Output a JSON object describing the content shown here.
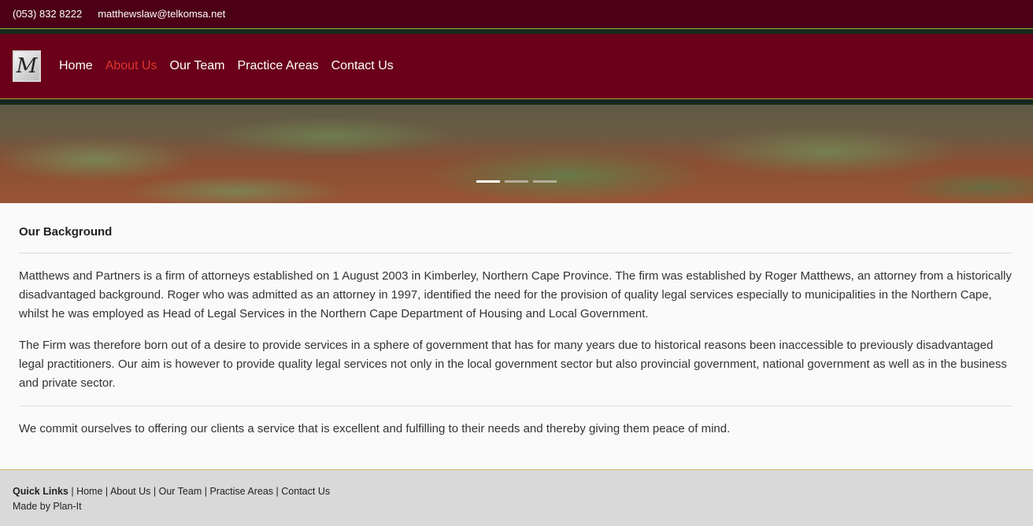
{
  "topbar": {
    "phone": "(053) 832 8222",
    "email": "matthewslaw@telkomsa.net"
  },
  "logo": {
    "letter": "M"
  },
  "nav": {
    "items": [
      {
        "label": "Home"
      },
      {
        "label": "About Us"
      },
      {
        "label": "Our Team"
      },
      {
        "label": "Practice Areas"
      },
      {
        "label": "Contact Us"
      }
    ],
    "active": "About Us"
  },
  "carousel": {
    "slides": 3,
    "active_index": 0
  },
  "content": {
    "heading": "Our Background",
    "paragraphs": [
      "Matthews and Partners is a firm of attorneys established on 1 August 2003 in Kimberley, Northern Cape Province. The firm was established by Roger Matthews, an attorney from a historically disadvantaged background. Roger who was admitted as an attorney in 1997, identified the need for the provision of quality legal services especially to municipalities in the Northern Cape, whilst he was employed as Head of Legal Services in the Northern Cape Department of Housing and Local Government.",
      "The Firm was therefore born out of a desire to provide services in a sphere of government that has for many years due to historical reasons been inaccessible to previously disadvantaged legal practitioners. Our aim is however to provide quality legal services not only in the local government sector but also provincial government, national government as well as in the business and private sector.",
      "We commit ourselves to offering our clients a service that is excellent and fulfilling to their needs and thereby giving them peace of mind."
    ]
  },
  "footer": {
    "quick_links_label": "Quick Links",
    "separator": "|",
    "links": [
      "Home",
      "About Us",
      "Our Team",
      "Practise Areas",
      "Contact Us"
    ],
    "credit": "Made by Plan-It"
  },
  "colors": {
    "topbar": "#4c0017",
    "navbar": "#6a0019",
    "stripe": "#17291e",
    "gold_line": "#b59b2f",
    "active_nav": "#e0352e",
    "footer": "#d9d9d9"
  }
}
